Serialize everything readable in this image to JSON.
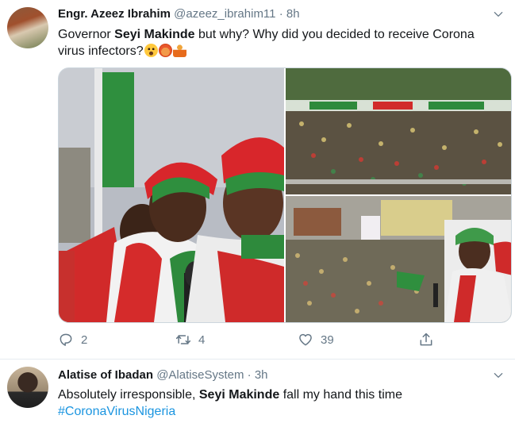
{
  "tweets": [
    {
      "author_name": "Engr. Azeez Ibrahim",
      "handle": "@azeez_ibrahim11",
      "separator": "·",
      "time": "8h",
      "text_part1": "Governor ",
      "text_bold": "Seyi Makinde",
      "text_part2": " but why? Why did you decided to receive Corona virus infectors?",
      "emojis": [
        "astonished-face-emoji",
        "ear-emoji",
        "person-emoji"
      ],
      "photos": [
        "campaign-leaders-photo",
        "crowd-rally-photo",
        "crowd-street-photo"
      ],
      "reply_count": "2",
      "retweet_count": "4",
      "like_count": "39"
    },
    {
      "author_name": "Alatise of Ibadan",
      "handle": "@AlatiseSystem",
      "separator": "·",
      "time": "3h",
      "text_part1": "Absolutely irresponsible, ",
      "text_bold": "Seyi Makinde",
      "text_part2": " fall my hand this time",
      "hashtag": "#CoronaVirusNigeria"
    }
  ],
  "colors": {
    "text": "#14171a",
    "muted": "#657786",
    "link": "#1b95e0",
    "divider": "#e6ecf0"
  },
  "icons": [
    "chevron-down-icon",
    "reply-icon",
    "retweet-icon",
    "like-icon",
    "share-icon"
  ]
}
